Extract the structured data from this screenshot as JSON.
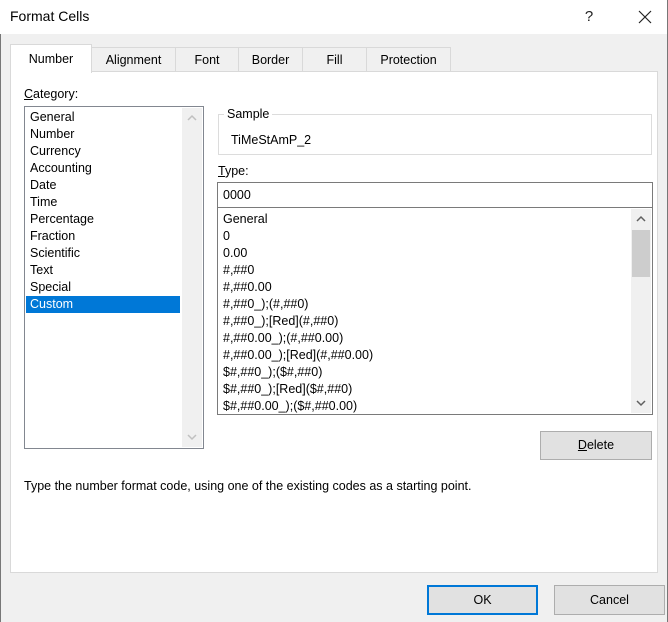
{
  "window": {
    "title": "Format Cells",
    "help_label": "?",
    "close_icon": "close-icon"
  },
  "tabs": [
    {
      "label": "Number",
      "active": true
    },
    {
      "label": "Alignment",
      "active": false
    },
    {
      "label": "Font",
      "active": false
    },
    {
      "label": "Border",
      "active": false
    },
    {
      "label": "Fill",
      "active": false
    },
    {
      "label": "Protection",
      "active": false
    }
  ],
  "category": {
    "label_first": "C",
    "label_rest": "ategory:",
    "items": [
      "General",
      "Number",
      "Currency",
      "Accounting",
      "Date",
      "Time",
      "Percentage",
      "Fraction",
      "Scientific",
      "Text",
      "Special",
      "Custom"
    ],
    "selected": "Custom"
  },
  "sample": {
    "legend": "Sample",
    "value": "TiMeStAmP_2"
  },
  "type": {
    "label_first": "T",
    "label_rest": "ype:",
    "value": "0000",
    "items": [
      "General",
      "0",
      "0.00",
      "#,##0",
      "#,##0.00",
      "#,##0_);(#,##0)",
      "#,##0_);[Red](#,##0)",
      "#,##0.00_);(#,##0.00)",
      "#,##0.00_);[Red](#,##0.00)",
      "$#,##0_);($#,##0)",
      "$#,##0_);[Red]($#,##0)",
      "$#,##0.00_);($#,##0.00)"
    ]
  },
  "buttons": {
    "delete_first": "D",
    "delete_rest": "elete",
    "ok": "OK",
    "cancel": "Cancel"
  },
  "hint": "Type the number format code, using one of the existing codes as a starting point.",
  "colors": {
    "selection": "#0078d7",
    "default_button_border": "#0078d7"
  }
}
